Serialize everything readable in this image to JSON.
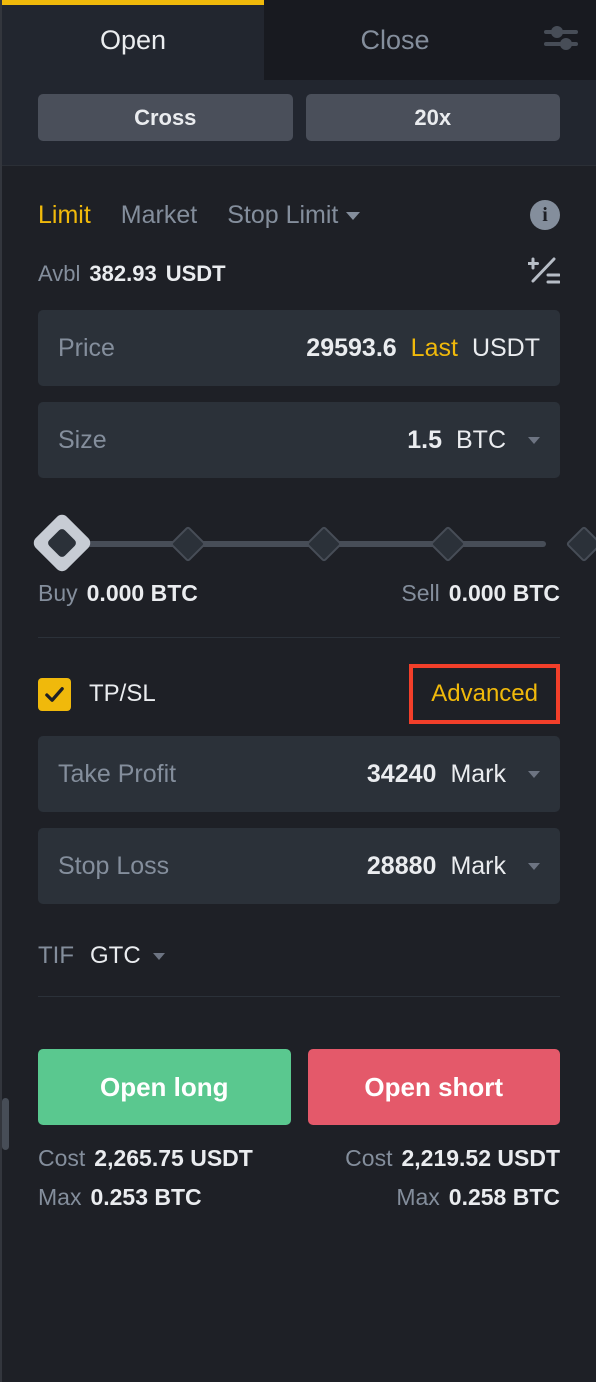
{
  "header": {
    "tabs": [
      {
        "label": "Open",
        "active": true
      },
      {
        "label": "Close",
        "active": false
      }
    ],
    "settings_icon": "sliders-icon"
  },
  "margin": {
    "mode_label": "Cross",
    "leverage_label": "20x"
  },
  "order_types": [
    {
      "label": "Limit",
      "active": true
    },
    {
      "label": "Market",
      "active": false
    },
    {
      "label": "Stop Limit",
      "active": false,
      "has_dropdown": true
    }
  ],
  "info_icon": "info-icon",
  "available": {
    "label": "Avbl",
    "amount": "382.93",
    "currency": "USDT",
    "transfer_icon": "transfer-icon"
  },
  "price_field": {
    "label": "Price",
    "value": "29593.6",
    "mode": "Last",
    "currency": "USDT"
  },
  "size_field": {
    "label": "Size",
    "value": "1.5",
    "unit": "BTC"
  },
  "slider": {
    "value_percent": 0,
    "ticks_percent": [
      0,
      25,
      50,
      75,
      100
    ]
  },
  "buy_sell": {
    "buy_label": "Buy",
    "buy_value": "0.000 BTC",
    "sell_label": "Sell",
    "sell_value": "0.000 BTC"
  },
  "tpsl": {
    "checked": true,
    "label": "TP/SL",
    "advanced_label": "Advanced",
    "highlight_color": "#f23f2a",
    "take_profit": {
      "label": "Take Profit",
      "value": "34240",
      "trigger": "Mark"
    },
    "stop_loss": {
      "label": "Stop Loss",
      "value": "28880",
      "trigger": "Mark"
    }
  },
  "tif": {
    "label": "TIF",
    "value": "GTC"
  },
  "actions": {
    "long_label": "Open long",
    "short_label": "Open short",
    "long_color": "#5ac88f",
    "short_color": "#e4596a"
  },
  "summary": {
    "long": {
      "cost_label": "Cost",
      "cost_value": "2,265.75 USDT",
      "max_label": "Max",
      "max_value": "0.253 BTC"
    },
    "short": {
      "cost_label": "Cost",
      "cost_value": "2,219.52 USDT",
      "max_label": "Max",
      "max_value": "0.258 BTC"
    }
  }
}
